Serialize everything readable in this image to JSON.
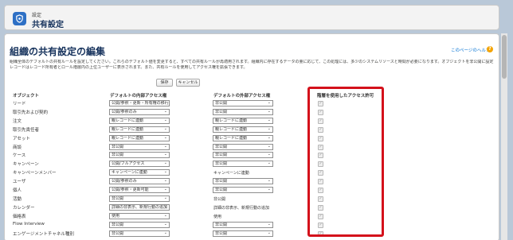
{
  "header": {
    "eyebrow": "設定",
    "title": "共有設定"
  },
  "page": {
    "title": "組織の共有設定の編集",
    "help_link": "このページのヘルプ",
    "description_line1": "組織全体のデフォルトの共有ルールを設定してください。これらのデフォルト値を変更すると、すべての共有ルールが再適用されます。組織内に存在するデータの量に応じて、この処理には、多少のシステムリソースと時間が必要になります。オブジェクトを非公開に設定すると、",
    "description_line2": "レコードはレコード所有者とロール階層内の上位ユーザーに表示されます。また、共有ルールを使用してアクセス権を拡張できます。"
  },
  "toolbar": {
    "save_label": "保存",
    "cancel_label": "キャンセル"
  },
  "columns": {
    "object": "オブジェクト",
    "internal": "デフォルトの内部アクセス権",
    "external": "デフォルトの外部アクセス権",
    "hierarchy": "階層を使用したアクセス許可"
  },
  "rows": [
    {
      "object": "リード",
      "internal": "公開/参照・更新・所有権の移行",
      "external": "非公開"
    },
    {
      "object": "取引先および契約",
      "internal": "公開/参照のみ",
      "external": "非公開"
    },
    {
      "object": "注文",
      "internal": "親レコードに連動",
      "external": "親レコードに連動"
    },
    {
      "object": "取引先責任者",
      "internal": "親レコードに連動",
      "external": "親レコードに連動"
    },
    {
      "object": "アセット",
      "internal": "親レコードに連動",
      "external": "親レコードに連動"
    },
    {
      "object": "商談",
      "internal": "非公開",
      "external": "非公開"
    },
    {
      "object": "ケース",
      "internal": "非公開",
      "external": "非公開"
    },
    {
      "object": "キャンペーン",
      "internal": "公開/フルアクセス",
      "external": "非公開"
    },
    {
      "object": "キャンペーンメンバー",
      "internal": "キャンペーンに連動",
      "external": "キャンペーンに連動"
    },
    {
      "object": "ユーザ",
      "internal": "公開/参照のみ",
      "external": "非公開"
    },
    {
      "object": "個人",
      "internal": "公開/参照・更新可能",
      "external": "非公開"
    },
    {
      "object": "活動",
      "internal": "非公開",
      "external": "非公開"
    },
    {
      "object": "カレンダー",
      "internal": "詳細の非表示、新規行動の追加",
      "external": "詳細の非表示、新規行動の追加"
    },
    {
      "object": "価格表",
      "internal": "使用",
      "external": "使用"
    },
    {
      "object": "Flow Interview",
      "internal": "非公開",
      "external": "非公開"
    },
    {
      "object": "エンゲージメントチャネル種別",
      "internal": "非公開",
      "external": "非公開"
    }
  ]
}
